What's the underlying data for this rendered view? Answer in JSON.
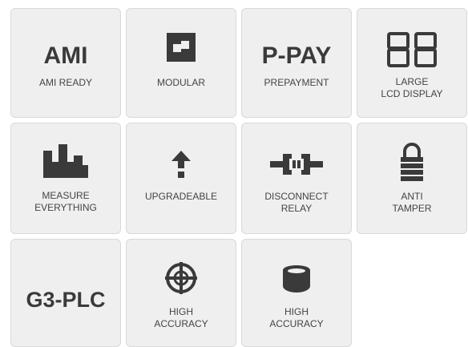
{
  "colors": {
    "tile_bg": "#efefef",
    "tile_border": "#d9d9d9",
    "icon": "#3a3a3a",
    "text": "#444444"
  },
  "tiles": [
    {
      "big": "AMI",
      "caption": "AMI READY"
    },
    {
      "icon": "modular-icon",
      "caption": "MODULAR"
    },
    {
      "big": "P-PAY",
      "caption": "PREPAYMENT"
    },
    {
      "icon": "lcd-display-icon",
      "caption": "LARGE\nLCD DISPLAY"
    },
    {
      "icon": "bar-chart-icon",
      "caption": "MEASURE\nEVERYTHING"
    },
    {
      "icon": "arrow-up-icon",
      "caption": "UPGRADEABLE"
    },
    {
      "icon": "disconnect-plug-icon",
      "caption": "DISCONNECT\nRELAY"
    },
    {
      "icon": "padlock-icon",
      "caption": "ANTI\nTAMPER"
    },
    {
      "big": "G3-PLC"
    },
    {
      "icon": "crosshair-icon",
      "caption": "HIGH\nACCURACY"
    },
    {
      "icon": "database-icon",
      "caption": "HIGH\nACCURACY"
    }
  ]
}
